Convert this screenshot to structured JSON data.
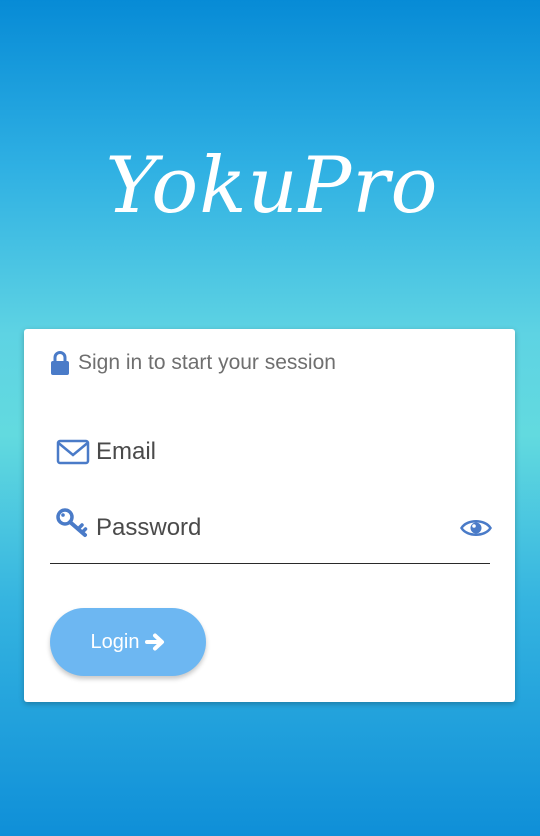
{
  "brand": {
    "logo_text": "YokuPro"
  },
  "login_card": {
    "header_icon": "lock-icon",
    "title": "Sign in to start your session",
    "email": {
      "icon": "envelope-icon",
      "placeholder": "Email",
      "value": ""
    },
    "password": {
      "icon": "key-icon",
      "placeholder": "Password",
      "value": "",
      "toggle_icon": "eye-icon"
    },
    "login_button": {
      "label": "Login",
      "icon": "arrow-right-icon"
    }
  },
  "colors": {
    "background_top": "#078bd6",
    "background_middle": "#62dadf",
    "background_bottom": "#0f8fd8",
    "icon_blue": "#4a7bc8",
    "button": "#6db7f2",
    "text_gray": "#6f6f6f"
  }
}
